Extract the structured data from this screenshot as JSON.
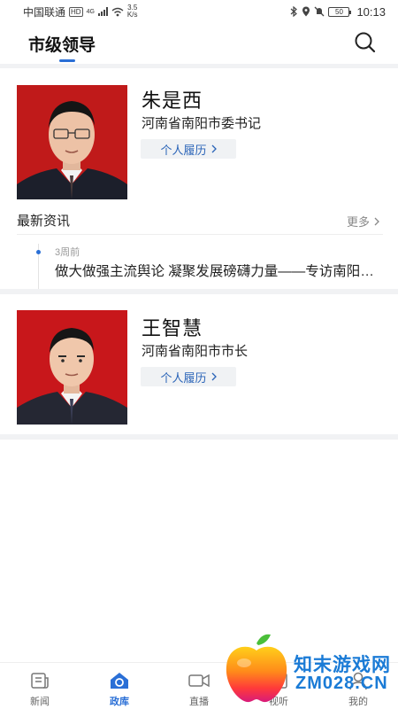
{
  "status_bar": {
    "carrier": "中国联通",
    "hd": "HD",
    "network": "4G",
    "speed_value": "3.5",
    "speed_unit": "K/s",
    "battery": "50",
    "time": "10:13"
  },
  "header": {
    "title": "市级领导",
    "accent_color": "#2a6fd6"
  },
  "leaders": [
    {
      "name": "朱是西",
      "position": "河南省南阳市委书记",
      "resume_label": "个人履历",
      "news_heading": "最新资讯",
      "more_label": "更多",
      "news": [
        {
          "time": "3周前",
          "title": "做大做强主流舆论 凝聚发展磅礴力量——专访南阳市委书记朱是西"
        }
      ]
    },
    {
      "name": "王智慧",
      "position": "河南省南阳市市长",
      "resume_label": "个人履历"
    }
  ],
  "bottom_nav": [
    {
      "label": "新闻",
      "icon": "news-icon",
      "active": false
    },
    {
      "label": "政库",
      "icon": "gov-library-icon",
      "active": true
    },
    {
      "label": "直播",
      "icon": "live-camera-icon",
      "active": false
    },
    {
      "label": "视听",
      "icon": "video-icon",
      "active": false
    },
    {
      "label": "我的",
      "icon": "profile-icon",
      "active": false
    }
  ],
  "watermark": {
    "line1": "知末游戏网",
    "line2": "ZM028.CN"
  }
}
